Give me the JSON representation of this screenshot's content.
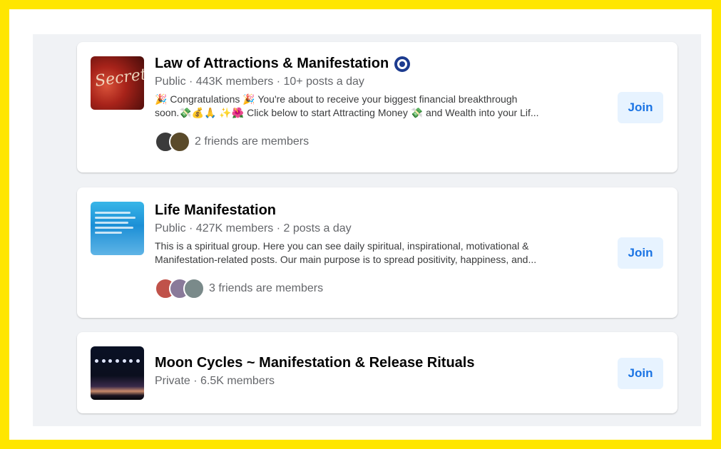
{
  "groups": [
    {
      "name": "Law of Attractions & Manifestation",
      "verified_icon": "evil-eye-icon",
      "meta": "Public · 443K members · 10+ posts a day",
      "description_line1": "🎉 Congratulations 🎉 You're about to receive your biggest financial breakthrough",
      "description_line2": "soon.💸💰🙏 ✨🌺 Click below to start Attracting Money 💸 and Wealth into your Lif...",
      "friends_text": "2 friends are members",
      "join_label": "Join",
      "avatar_colors": [
        "#3b3b3b",
        "#5a4a2a"
      ]
    },
    {
      "name": "Life Manifestation",
      "meta": "Public · 427K members · 2 posts a day",
      "description_line1": "This is a spiritual group. Here you can see daily spiritual, inspirational, motivational &",
      "description_line2": "Manifestation-related posts. Our main purpose is to spread positivity, happiness, and...",
      "friends_text": "3 friends are members",
      "join_label": "Join",
      "avatar_colors": [
        "#c0524a",
        "#8a7a9a",
        "#7a8a8a"
      ]
    },
    {
      "name": "Moon Cycles ~ Manifestation & Release Rituals",
      "meta": "Private · 6.5K members",
      "join_label": "Join"
    }
  ],
  "colors": {
    "accent": "#1b74e4",
    "join_bg": "#e7f3ff",
    "border": "#ffe600"
  }
}
